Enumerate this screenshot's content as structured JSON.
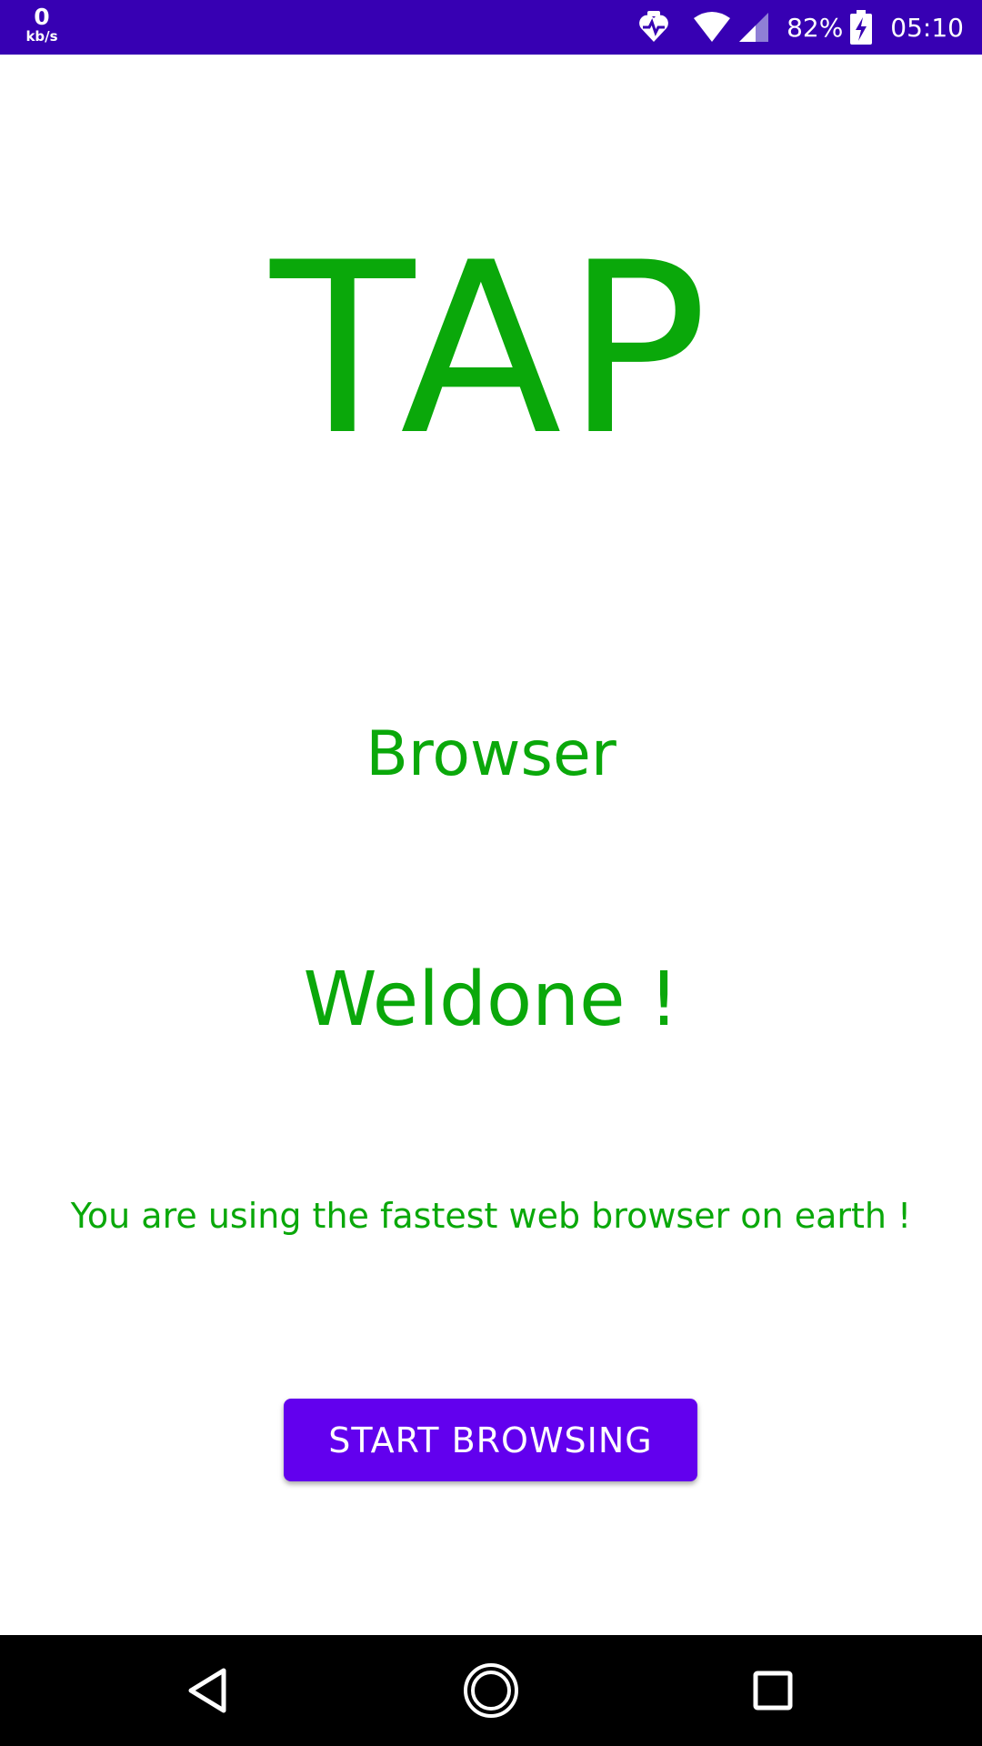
{
  "status_bar": {
    "net_speed_value": "0",
    "net_speed_unit": "kb/s",
    "battery_percent": "82%",
    "time": "05:10",
    "icons": [
      "heart-monitor-icon",
      "wifi-icon",
      "cell-signal-icon",
      "battery-charging-icon"
    ],
    "background_color": "#3700b3"
  },
  "main": {
    "logo_text": "TAP",
    "subtitle": "Browser",
    "welcome_text": "Weldone !",
    "tagline": "You are using the fastest web browser on earth !",
    "start_button_label": "START BROWSING",
    "text_color": "#0aa80a",
    "button_color": "#6200ee"
  },
  "nav_bar": {
    "icons": [
      "back-icon",
      "home-icon",
      "recents-icon"
    ]
  }
}
